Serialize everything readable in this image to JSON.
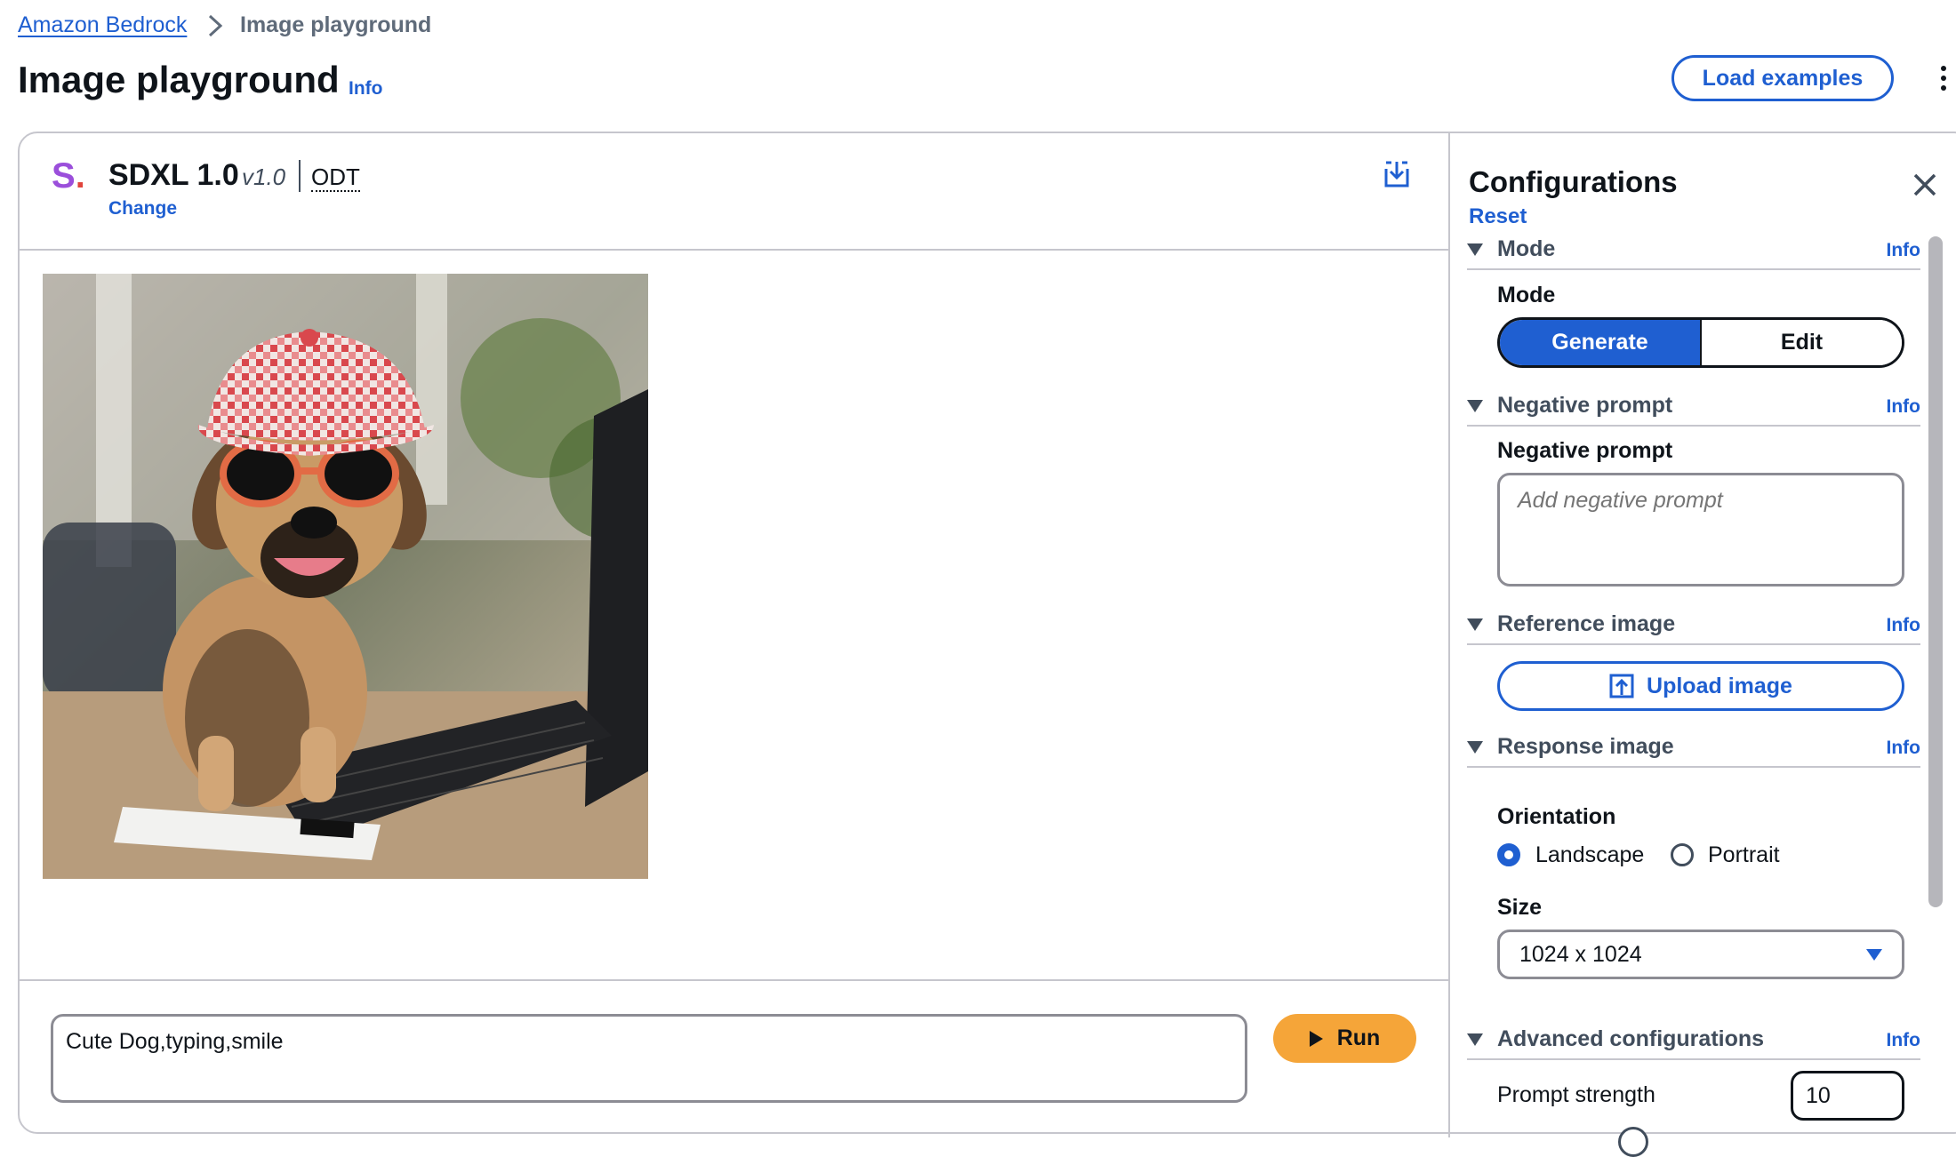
{
  "breadcrumb": {
    "parent": "Amazon Bedrock",
    "current": "Image playground"
  },
  "page": {
    "title": "Image playground",
    "info": "Info",
    "load_examples": "Load examples"
  },
  "model": {
    "logo_letter": "S",
    "logo_dot": ".",
    "name": "SDXL 1.0",
    "version": "v1.0",
    "tag": "ODT",
    "change": "Change"
  },
  "prompt": {
    "value": "Cute Dog,typing,smile",
    "run_label": "Run"
  },
  "config": {
    "title": "Configurations",
    "reset": "Reset",
    "mode": {
      "section": "Mode",
      "info": "Info",
      "label": "Mode",
      "options": [
        "Generate",
        "Edit"
      ],
      "selected": "Generate"
    },
    "negative": {
      "section": "Negative prompt",
      "info": "Info",
      "label": "Negative prompt",
      "placeholder": "Add negative prompt"
    },
    "reference": {
      "section": "Reference image",
      "info": "Info",
      "upload_label": "Upload image"
    },
    "response": {
      "section": "Response image",
      "info": "Info",
      "orientation_label": "Orientation",
      "orientations": [
        "Landscape",
        "Portrait"
      ],
      "selected_orientation": "Landscape",
      "size_label": "Size",
      "size_value": "1024 x 1024"
    },
    "advanced": {
      "section": "Advanced configurations",
      "info": "Info",
      "prompt_strength_label": "Prompt strength",
      "prompt_strength_value": "10"
    }
  },
  "colors": {
    "accent": "#1f5fd1",
    "run": "#f5a539",
    "border": "#c6c6cd"
  }
}
